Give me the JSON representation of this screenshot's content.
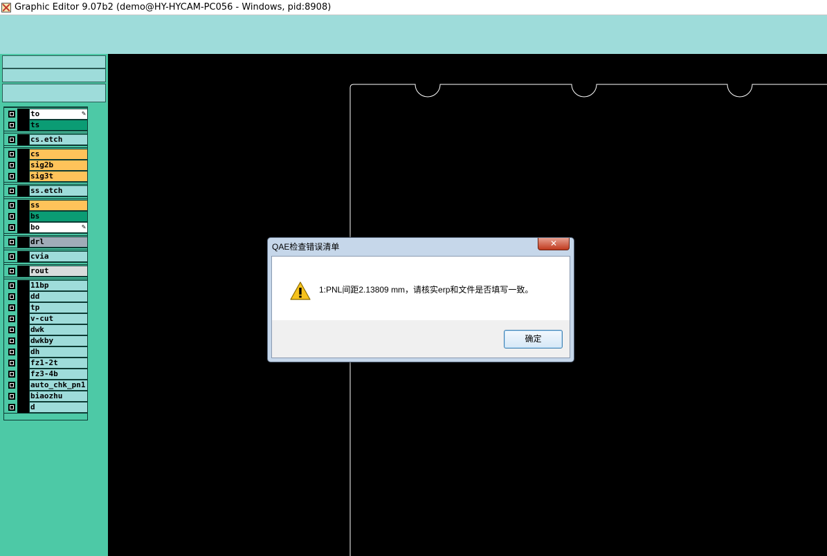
{
  "window": {
    "title": "Graphic Editor 9.07b2 (demo@HY-HYCAM-PC056 - Windows, pid:8908)"
  },
  "layers": [
    {
      "name": "to",
      "color": "#ffffff",
      "pinned": true
    },
    {
      "name": "ts",
      "color": "#0b9c74",
      "pinned": false
    },
    {
      "name": "cs.etch",
      "color": "#9edcda",
      "pinned": false
    },
    {
      "name": "cs",
      "color": "#ffc35a",
      "pinned": false
    },
    {
      "name": "sig2b",
      "color": "#ffc35a",
      "pinned": false
    },
    {
      "name": "sig3t",
      "color": "#ffc35a",
      "pinned": false
    },
    {
      "name": "ss.etch",
      "color": "#9edcda",
      "pinned": false
    },
    {
      "name": "ss",
      "color": "#ffc35a",
      "pinned": false
    },
    {
      "name": "bs",
      "color": "#0b9c74",
      "pinned": false
    },
    {
      "name": "bo",
      "color": "#ffffff",
      "pinned": true
    },
    {
      "name": "drl",
      "color": "#a0acb8",
      "pinned": false
    },
    {
      "name": "cvia",
      "color": "#9edcda",
      "pinned": false
    },
    {
      "name": "rout",
      "color": "#d8dcdc",
      "pinned": false
    },
    {
      "name": "11bp",
      "color": "#9edcda",
      "pinned": false
    },
    {
      "name": "dd",
      "color": "#9edcda",
      "pinned": false
    },
    {
      "name": "tp",
      "color": "#9edcda",
      "pinned": false
    },
    {
      "name": "v-cut",
      "color": "#9edcda",
      "pinned": false
    },
    {
      "name": "dwk",
      "color": "#9edcda",
      "pinned": false
    },
    {
      "name": "dwkby",
      "color": "#9edcda",
      "pinned": false
    },
    {
      "name": "dh",
      "color": "#9edcda",
      "pinned": false
    },
    {
      "name": "fz1-2t",
      "color": "#9edcda",
      "pinned": false
    },
    {
      "name": "fz3-4b",
      "color": "#9edcda",
      "pinned": false
    },
    {
      "name": "auto_chk_pn1",
      "color": "#9edcda",
      "pinned": false
    },
    {
      "name": "biaozhu",
      "color": "#9edcda",
      "pinned": false
    },
    {
      "name": "d",
      "color": "#9edcda",
      "pinned": false
    }
  ],
  "dialog": {
    "title": "QAE检查错误清单",
    "message": "1:PNL间距2.13809 mm，请核实erp和文件是否填写一致。",
    "ok_label": "确定",
    "close_glyph": "✕"
  }
}
